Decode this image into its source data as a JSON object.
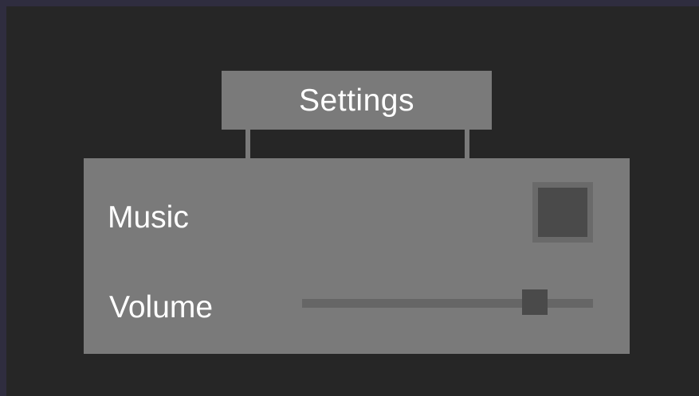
{
  "settings": {
    "title": "Settings",
    "music": {
      "label": "Music",
      "checked": false
    },
    "volume": {
      "label": "Volume",
      "value": 0.8
    }
  },
  "colors": {
    "frame": "#2f2d3f",
    "background": "#262626",
    "panel": "#7a7a7a",
    "text": "#ffffff",
    "checkbox_border": "#6a6a6a",
    "checkbox_fill": "#4a4a4a",
    "slider_track": "#666666",
    "slider_handle": "#4a4a4a"
  }
}
